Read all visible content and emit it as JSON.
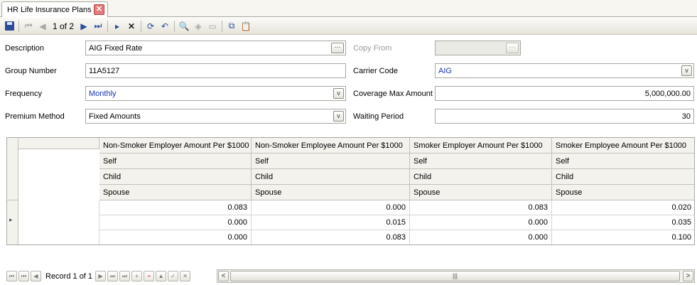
{
  "tab": {
    "title": "HR Life Insurance Plans",
    "close_glyph": "✕"
  },
  "toolbar": {
    "record_position": "1 of 2"
  },
  "form": {
    "description_label": "Description",
    "description_value": "AIG Fixed Rate",
    "copy_from_label": "Copy From",
    "copy_from_value": "",
    "group_number_label": "Group Number",
    "group_number_value": "11A5127",
    "carrier_code_label": "Carrier Code",
    "carrier_code_value": "AIG",
    "frequency_label": "Frequency",
    "frequency_value": "Monthly",
    "coverage_max_label": "Coverage Max Amount",
    "coverage_max_value": "5,000,000.00",
    "premium_method_label": "Premium Method",
    "premium_method_value": "Fixed Amounts",
    "waiting_period_label": "Waiting Period",
    "waiting_period_value": "30"
  },
  "grid": {
    "columns": [
      "Non-Smoker Employer Amount Per $1000",
      "Non-Smoker Employee Amount Per $1000",
      "Smoker Employer Amount Per $1000",
      "Smoker Employee Amount Per $1000"
    ],
    "subrows": [
      "Self",
      "Child",
      "Spouse"
    ],
    "rows": [
      [
        "0.083",
        "0.000",
        "0.083",
        "0.020"
      ],
      [
        "0.000",
        "0.015",
        "0.000",
        "0.035"
      ],
      [
        "0.000",
        "0.083",
        "0.000",
        "0.100"
      ]
    ]
  },
  "navigator": {
    "record_text": "Record 1 of 1"
  },
  "icons": {
    "first": "⏮",
    "prev": "◀",
    "next": "▶",
    "last": "⏭",
    "new": "▸",
    "delete": "✕",
    "refresh": "⟳",
    "undo": "↶",
    "find": "🔍",
    "copy": "⧉",
    "paste": "📋",
    "add": "+",
    "remove": "−",
    "up": "▲",
    "check": "✓",
    "cancel": "✕",
    "scroll_left": "<",
    "scroll_right": ">",
    "thumb": "|||",
    "dropdown": "v",
    "ellipsis": "···",
    "row_pointer": "▸"
  },
  "colors": {
    "link_blue": "#1a34b6",
    "accent": "#2a4d9b"
  }
}
